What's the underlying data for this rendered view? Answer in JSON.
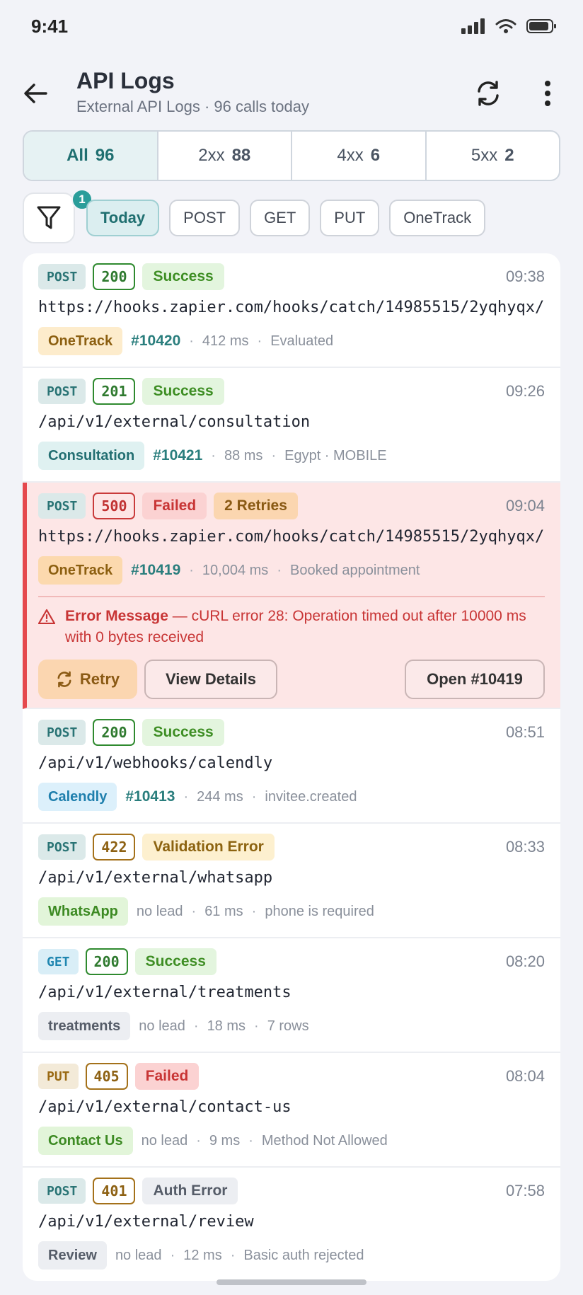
{
  "status_bar": {
    "time": "9:41"
  },
  "header": {
    "title": "API Logs",
    "subtitle": "External API Logs · 96 calls today"
  },
  "tabs": [
    {
      "label": "All",
      "count": "96",
      "active": true
    },
    {
      "label": "2xx",
      "count": "88"
    },
    {
      "label": "4xx",
      "count": "6"
    },
    {
      "label": "5xx",
      "count": "2"
    }
  ],
  "filter": {
    "badge_count": "1",
    "chips": [
      "Today",
      "POST",
      "GET",
      "PUT",
      "OneTrack"
    ]
  },
  "logs": [
    {
      "method": "POST",
      "code": "200",
      "status": "Success",
      "time": "09:38",
      "url": "https://hooks.zapier.com/hooks/catch/14985515/2yqhyqx/",
      "source": "OneTrack",
      "lead": "#10420",
      "duration": "412 ms",
      "note": "Evaluated"
    },
    {
      "method": "POST",
      "code": "201",
      "status": "Success",
      "time": "09:26",
      "url": "/api/v1/external/consultation",
      "source": "Consultation",
      "lead": "#10421",
      "duration": "88 ms",
      "note": "Egypt · MOBILE"
    },
    {
      "method": "POST",
      "code": "500",
      "status": "Failed",
      "retries": "2 Retries",
      "time": "09:04",
      "url": "https://hooks.zapier.com/hooks/catch/14985515/2yqhyqx/",
      "source": "OneTrack",
      "lead": "#10419",
      "duration": "10,004 ms",
      "note": "Booked appointment",
      "error_label": "Error Message",
      "error_text": " — cURL error 28: Operation timed out after 10000 ms with 0 bytes received",
      "actions": {
        "retry": "Retry",
        "view": "View Details",
        "open": "Open #10419"
      }
    },
    {
      "method": "POST",
      "code": "200",
      "status": "Success",
      "time": "08:51",
      "url": "/api/v1/webhooks/calendly",
      "source": "Calendly",
      "lead": "#10413",
      "duration": "244 ms",
      "note": "invitee.created"
    },
    {
      "method": "POST",
      "code": "422",
      "status": "Validation Error",
      "time": "08:33",
      "url": "/api/v1/external/whatsapp",
      "source": "WhatsApp",
      "lead": "no lead",
      "duration": "61 ms",
      "note": "phone is required"
    },
    {
      "method": "GET",
      "code": "200",
      "status": "Success",
      "time": "08:20",
      "url": "/api/v1/external/treatments",
      "source": "treatments",
      "lead": "no lead",
      "duration": "18 ms",
      "note": "7 rows"
    },
    {
      "method": "PUT",
      "code": "405",
      "status": "Failed",
      "time": "08:04",
      "url": "/api/v1/external/contact-us",
      "source": "Contact Us",
      "lead": "no lead",
      "duration": "9 ms",
      "note": "Method Not Allowed"
    },
    {
      "method": "POST",
      "code": "401",
      "status": "Auth Error",
      "time": "07:58",
      "url": "/api/v1/external/review",
      "source": "Review",
      "lead": "no lead",
      "duration": "12 ms",
      "note": "Basic auth rejected"
    }
  ],
  "colors": {
    "accent": "#2a9d9a",
    "error": "#e5484d",
    "success": "#3e8e24"
  }
}
